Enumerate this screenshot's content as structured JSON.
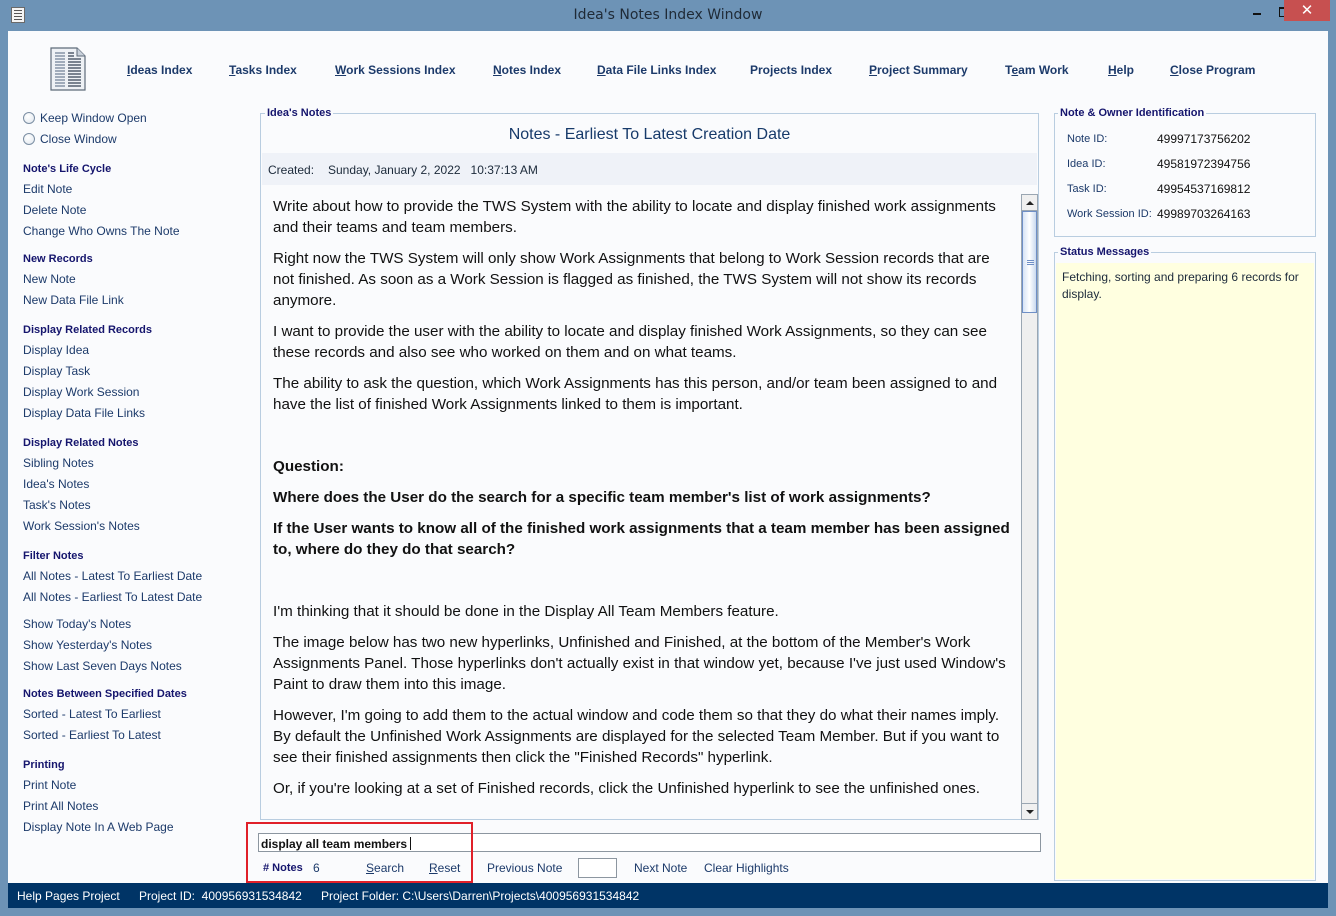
{
  "window": {
    "title": "Idea's Notes Index Window",
    "close_glyph": "✕"
  },
  "topnav": [
    {
      "label": "Ideas Index",
      "mnemonic": "I"
    },
    {
      "label": "Tasks Index",
      "mnemonic": "T"
    },
    {
      "label": "Work Sessions Index",
      "mnemonic": "W"
    },
    {
      "label": "Notes Index",
      "mnemonic": "N"
    },
    {
      "label": "Data File Links Index",
      "mnemonic": "D"
    },
    {
      "label": "Projects Index",
      "mnemonic": ""
    },
    {
      "label": "Project Summary",
      "mnemonic": "P"
    },
    {
      "label": "Team Work",
      "mnemonic": "e"
    },
    {
      "label": "Help",
      "mnemonic": "H"
    },
    {
      "label": "Close Program",
      "mnemonic": "C"
    }
  ],
  "window_options": {
    "keep_open": "Keep Window Open",
    "close_window": "Close Window"
  },
  "sidebar": {
    "life_cycle": {
      "heading": "Note's Life Cycle",
      "items": [
        "Edit Note",
        "Delete Note",
        "Change Who Owns The Note"
      ]
    },
    "new_records": {
      "heading": "New Records",
      "items": [
        "New Note",
        "New Data File Link"
      ]
    },
    "related_records": {
      "heading": "Display Related Records",
      "items": [
        "Display Idea",
        "Display Task",
        "Display Work Session",
        "Display Data File Links"
      ]
    },
    "related_notes": {
      "heading": "Display Related Notes",
      "items": [
        "Sibling Notes",
        "Idea's Notes",
        "Task's Notes",
        "Work Session's Notes"
      ]
    },
    "filter_notes": {
      "heading": "Filter Notes",
      "items": [
        "All Notes - Latest To Earliest Date",
        "All Notes - Earliest To Latest Date",
        "Show Today's Notes",
        "Show Yesterday's Notes",
        "Show Last Seven Days Notes"
      ]
    },
    "between_dates": {
      "heading": "Notes Between Specified Dates",
      "items": [
        "Sorted - Latest To Earliest",
        "Sorted - Earliest To Latest"
      ]
    },
    "printing": {
      "heading": "Printing",
      "items": [
        "Print Note",
        "Print All Notes",
        "Display Note In A Web Page"
      ]
    }
  },
  "notes_panel": {
    "legend": "Idea's Notes",
    "heading": "Notes - Earliest To Latest Creation Date",
    "created_label": "Created:",
    "created_value": "Sunday, January 2, 2022   10:37:13 AM",
    "paragraphs": [
      "Write about how to provide the TWS System with the ability to locate and display finished work assignments and their teams and team members.",
      "Right now the TWS System will only show Work Assignments that belong to Work Session records that are not finished. As soon as a Work Session is flagged as finished, the TWS System will not show its records anymore.",
      "I want to provide the user with the ability to locate and display finished Work Assignments, so they can see these records and also see who worked on them and on what teams.",
      "The ability to ask the question, which Work Assignments has this person, and/or team been assigned to and have the list of finished Work Assignments linked to them is important.",
      "Question:",
      "Where does the User do the search for a specific team member's list of work assignments?",
      "If the User wants to know all of the finished work assignments that a team member has been assigned to, where do they do that search?",
      "I'm thinking that it should be done in the Display All Team Members feature.",
      "The image below has two new hyperlinks, Unfinished and Finished, at the bottom of the Member's Work Assignments Panel. Those hyperlinks don't actually exist in that window yet, because I've just used Window's Paint to draw them into this image.",
      "However, I'm going to add them to the actual window and code them so that they do what their names imply. By default the Unfinished Work Assignments are displayed for the selected Team Member. But if you want to see their finished assignments then click the \"Finished Records\" hyperlink.",
      "Or, if you're looking at a set of Finished records, click the Unfinished hyperlink to see the unfinished ones."
    ]
  },
  "search": {
    "value": "display all team members",
    "notes_count_label": "# Notes",
    "notes_count": "6",
    "search_label": "Search",
    "reset_label": "Reset",
    "previous_label": "Previous Note",
    "note_number_value": "",
    "next_label": "Next Note",
    "clear_label": "Clear Highlights"
  },
  "identification": {
    "legend": "Note & Owner Identification",
    "rows": [
      {
        "label": "Note ID:",
        "value": "49997173756202"
      },
      {
        "label": "Idea ID:",
        "value": "49581972394756"
      },
      {
        "label": "Task ID:",
        "value": "49954537169812"
      },
      {
        "label": "Work Session ID:",
        "value": "49989703264163"
      }
    ]
  },
  "status": {
    "legend": "Status Messages",
    "message": "Fetching, sorting and preparing 6 records for display."
  },
  "statusbar": {
    "project_name": "Help Pages Project",
    "project_id": "Project ID:  400956931534842",
    "project_folder": "Project Folder: C:\\Users\\Darren\\Projects\\400956931534842"
  }
}
